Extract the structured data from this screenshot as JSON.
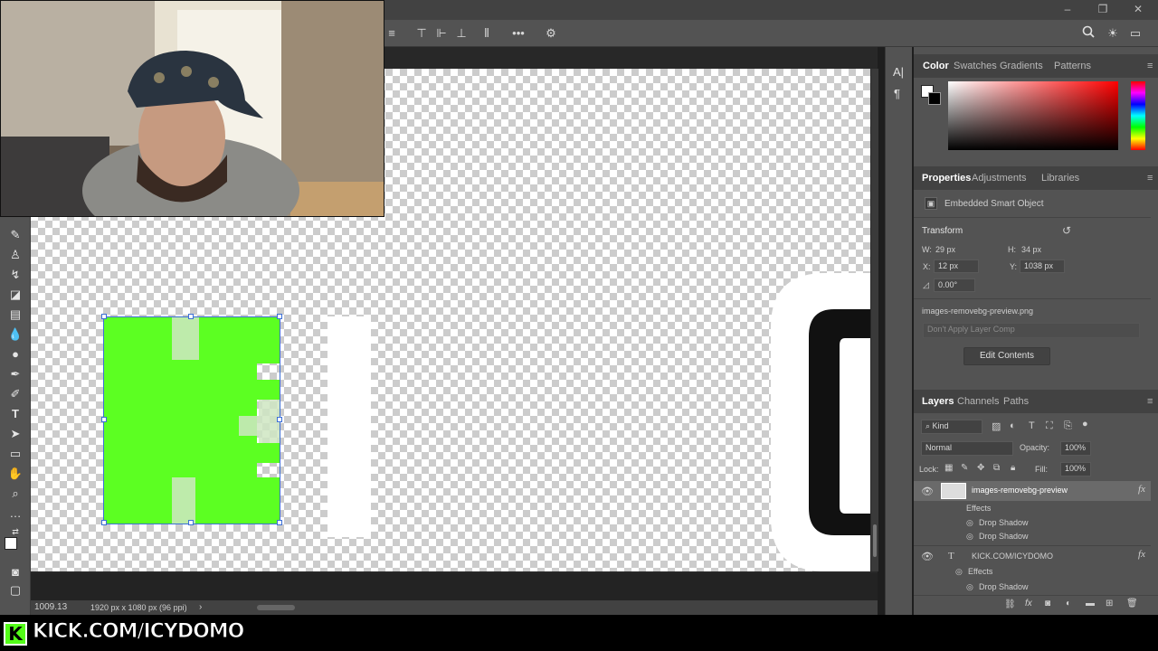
{
  "options_bar": {
    "icons": [
      "align-left-icon",
      "align-top-icon",
      "align-vcenter-icon",
      "align-bottom-icon",
      "distribute-icon",
      "more-icon",
      "gear-icon"
    ],
    "right_icons": [
      "search-icon",
      "bulb-icon",
      "workspace-icon"
    ]
  },
  "status": {
    "zoom": "1009.13",
    "doc_info": "1920 px x 1080 px (96 ppi)"
  },
  "color_panel": {
    "tabs": [
      "Color",
      "Swatches",
      "Gradients",
      "Patterns"
    ],
    "active_tab": "Color",
    "gradient_hue": "#ff0000"
  },
  "properties_panel": {
    "tabs": [
      "Properties",
      "Adjustments",
      "Libraries"
    ],
    "object_type": "Embedded Smart Object",
    "transform_label": "Transform",
    "w_label": "W:",
    "w_value": "29 px",
    "h_label": "H:",
    "h_value": "34 px",
    "x_label": "X:",
    "x_value": "12 px",
    "y_label": "Y:",
    "y_value": "1038 px",
    "angle_value": "0.00°",
    "file_name": "images-removebg-preview.png",
    "layer_comp_placeholder": "Don't Apply Layer Comp",
    "edit_button": "Edit Contents"
  },
  "layers_panel": {
    "tabs": [
      "Layers",
      "Channels",
      "Paths"
    ],
    "kind_label": "Kind",
    "blend_mode": "Normal",
    "opacity_label": "Opacity:",
    "opacity_value": "100%",
    "lock_label": "Lock:",
    "fill_label": "Fill:",
    "fill_value": "100%",
    "layers": [
      {
        "name": "images-removebg-preview",
        "effects_label": "Effects",
        "effects": [
          "Drop Shadow",
          "Drop Shadow"
        ]
      },
      {
        "name": "KICK.COM/ICYDOMO",
        "effects_label": "Effects",
        "effects": [
          "Drop Shadow"
        ]
      }
    ]
  },
  "overlay": {
    "brand_letter": "K",
    "brand_text": "KICK.COM/ICYDOMO"
  },
  "colors": {
    "accent_green": "#53fc18",
    "panel_bg": "#535353",
    "header_bg": "#424242"
  }
}
